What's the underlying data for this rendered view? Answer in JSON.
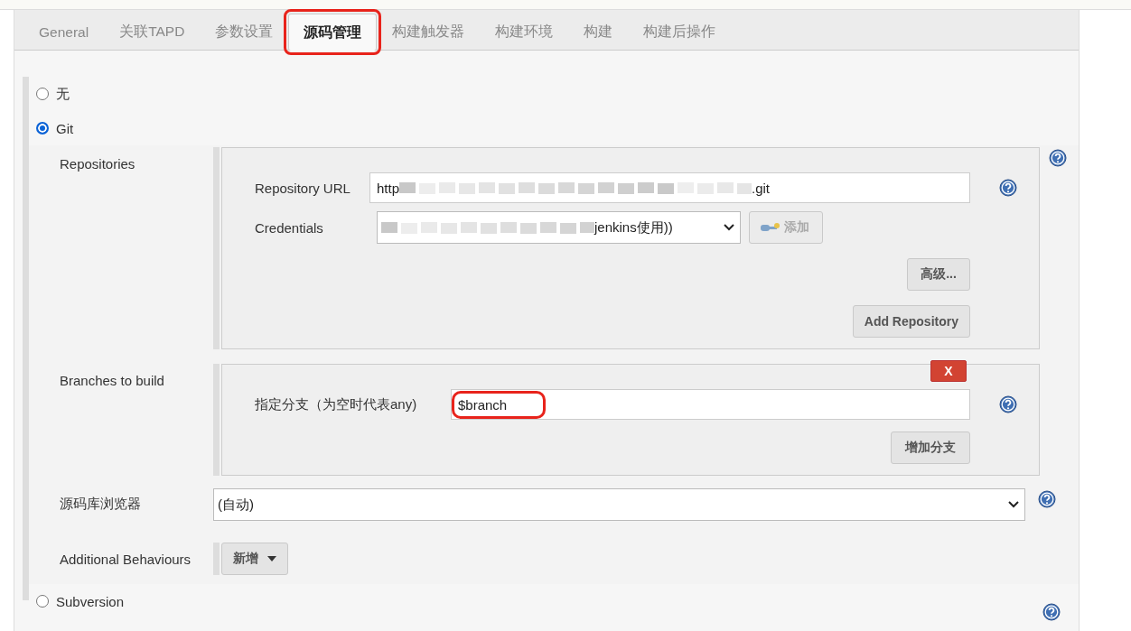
{
  "tabs": [
    {
      "label": "General",
      "selected": false,
      "highlighted": false
    },
    {
      "label": "关联TAPD",
      "selected": false,
      "highlighted": false
    },
    {
      "label": "参数设置",
      "selected": false,
      "highlighted": false
    },
    {
      "label": "源码管理",
      "selected": true,
      "highlighted": true
    },
    {
      "label": "构建触发器",
      "selected": false,
      "highlighted": false
    },
    {
      "label": "构建环境",
      "selected": false,
      "highlighted": false
    },
    {
      "label": "构建",
      "selected": false,
      "highlighted": false
    },
    {
      "label": "构建后操作",
      "selected": false,
      "highlighted": false
    }
  ],
  "scm_options": [
    {
      "label": "无",
      "selected": false
    },
    {
      "label": "Git",
      "selected": true
    }
  ],
  "repositories": {
    "label": "Repositories",
    "url_label": "Repository URL",
    "url_start": "http",
    "url_end": ".git",
    "credentials_label": "Credentials",
    "credentials_value": "jenkins使用))",
    "add_button": "添加",
    "advanced_button": "高级...",
    "add_repository_button": "Add Repository"
  },
  "branches": {
    "label": "Branches to build",
    "delete_button": "X",
    "branch_label": "指定分支（为空时代表any)",
    "branch_value": "$branch",
    "highlighted": true,
    "add_branch_button": "增加分支"
  },
  "browser": {
    "label": "源码库浏览器",
    "value": "(自动)"
  },
  "behaviours": {
    "label": "Additional Behaviours",
    "button": "新增"
  },
  "other_options": [
    {
      "label": "Subversion",
      "selected": false
    }
  ]
}
